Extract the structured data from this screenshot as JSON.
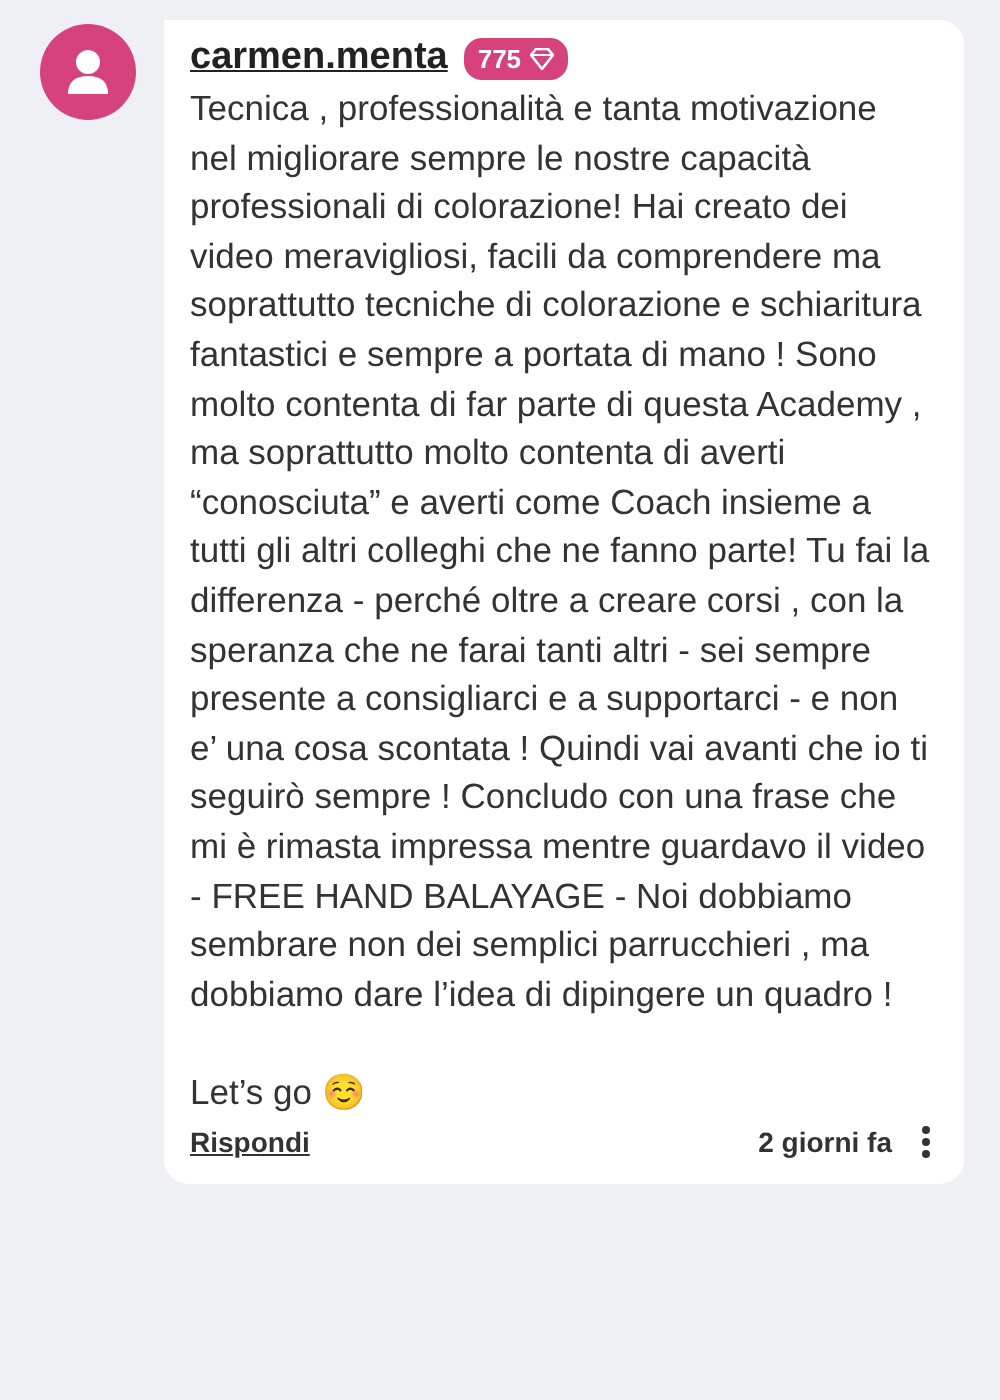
{
  "comment": {
    "author": "carmen.menta",
    "points": "775",
    "paragraphs": [
      "Tecnica , professionalità e tanta motivazione nel migliorare sempre le nostre capacità professionali di colorazione! Hai creato dei video meravigliosi, facili da comprendere ma soprattutto tecniche di colorazione e schiaritura fantastici e sempre a portata di mano ! Sono molto contenta di far parte di questa Academy , ma soprattutto molto contenta di averti “conosciuta” e averti come Coach insieme a tutti gli altri colleghi che ne fanno parte! Tu fai la differenza - perché oltre a creare corsi , con la speranza che ne farai tanti altri - sei sempre presente a consigliarci e a supportarci - e non e’ una cosa scontata ! Quindi vai avanti che io ti seguirò sempre ! Concludo con una frase che mi è rimasta impressa mentre guardavo il video - FREE HAND BALAYAGE - Noi dobbiamo sembrare non dei semplici parrucchieri , ma dobbiamo dare l’idea di dipingere un quadro !",
      "Let’s go ☺️"
    ],
    "reply": "Rispondi",
    "time": "2 giorni fa"
  }
}
